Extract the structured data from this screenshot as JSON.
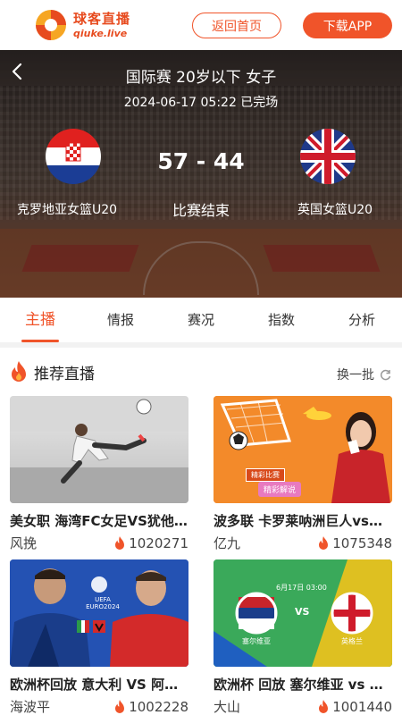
{
  "header": {
    "logo_cn": "球客直播",
    "logo_en": "qiuke.live",
    "home_button": "返回首页",
    "app_button": "下载APP"
  },
  "match": {
    "title": "国际赛 20岁以下 女子",
    "time": "2024-06-17 05:22 已完场",
    "score": "57 - 44",
    "status": "比赛结束",
    "home_team": "克罗地亚女篮U20",
    "away_team": "英国女篮U20"
  },
  "tabs": [
    {
      "label": "主播",
      "active": true
    },
    {
      "label": "情报",
      "active": false
    },
    {
      "label": "赛况",
      "active": false
    },
    {
      "label": "指数",
      "active": false
    },
    {
      "label": "分析",
      "active": false
    }
  ],
  "section": {
    "title": "推荐直播",
    "refresh_label": "换一批"
  },
  "streams": [
    {
      "title": "美女职 海湾FC女足VS犹他皇家女足",
      "anchor": "风挽",
      "views": "1020271",
      "thumb": "soccer-player-icon"
    },
    {
      "title": "波多联 卡罗莱呐洲巨人vs马亚圭斯",
      "anchor": "亿九",
      "views": "1075348",
      "thumb": "hostess-icon",
      "badge1": "精彩比赛",
      "badge2": "精彩解说"
    },
    {
      "title": "欧洲杯回放 意大利 VS 阿尔巴尼亚",
      "anchor": "海波平",
      "views": "1002228",
      "thumb": "euro-players-icon",
      "euro_label": "UEFA EURO2024"
    },
    {
      "title": "欧洲杯 回放 塞尔维亚 vs 英格兰",
      "anchor": "大山",
      "views": "1001440",
      "thumb": "euro-match-icon",
      "date_label": "6月17日 03:00",
      "vs": "VS",
      "team_a": "塞尔维亚",
      "team_b": "英格兰"
    }
  ],
  "colors": {
    "accent": "#f0542a"
  }
}
